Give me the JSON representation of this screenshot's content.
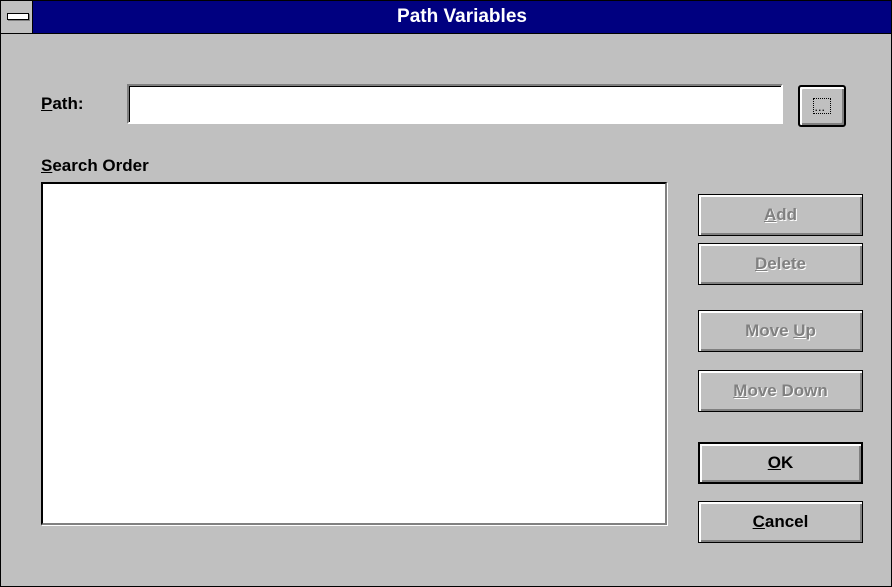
{
  "window": {
    "title": "Path Variables"
  },
  "path": {
    "label": "Path:",
    "value": "",
    "browse_icon": "ellipsis-browse-icon"
  },
  "search_order": {
    "label": "Search Order",
    "items": []
  },
  "buttons": {
    "add": "Add",
    "delete": "Delete",
    "move_up": "Move Up",
    "move_down": "Move Down",
    "ok": "OK",
    "cancel": "Cancel"
  },
  "colors": {
    "titlebar": "#000080",
    "face": "#c0c0c0",
    "disabled_text": "#808080"
  }
}
